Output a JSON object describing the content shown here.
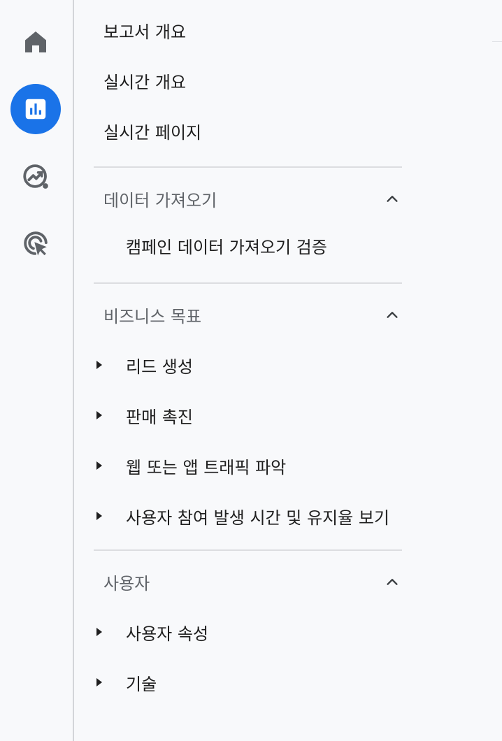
{
  "nav": {
    "top_items": [
      "보고서 개요",
      "실시간 개요",
      "실시간 페이지"
    ],
    "sections": [
      {
        "label": "데이터 가져오기",
        "items": [
          "캠페인 데이터 가져오기 검증"
        ]
      },
      {
        "label": "비즈니스 목표",
        "items": [
          "리드 생성",
          "판매 촉진",
          "웹 또는 앱 트래픽 파악",
          "사용자 참여 발생 시간 및 유지율 보기"
        ]
      },
      {
        "label": "사용자",
        "items": [
          "사용자 속성",
          "기술"
        ]
      }
    ]
  },
  "rail": {
    "icons": [
      "home-icon",
      "reports-icon",
      "explore-icon",
      "advertising-icon"
    ],
    "active": "reports-icon"
  },
  "colors": {
    "accent": "#1a73e8",
    "icon": "#5f6368",
    "text": "#1f1f1f",
    "muted": "#5f6368"
  }
}
